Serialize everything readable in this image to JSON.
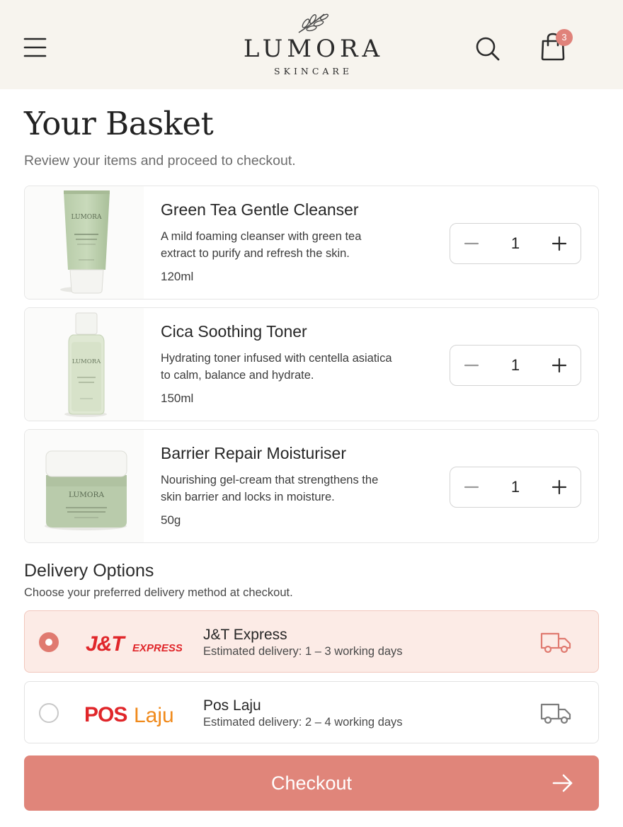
{
  "brand": {
    "name": "LUMORA",
    "tagline": "SKINCARE",
    "accent": "#e0857a"
  },
  "header": {
    "menu_icon": "menu-icon",
    "search_icon": "search-icon",
    "bag_icon": "shopping-bag-icon",
    "cart_count": "3"
  },
  "page": {
    "title": "Your Basket",
    "subtitle": "Review your items and proceed to checkout."
  },
  "items": [
    {
      "name": "Green Tea Gentle Cleanser",
      "description": "A mild foaming cleanser with green tea extract to purify and refresh the skin.",
      "size": "120ml",
      "quantity": "1"
    },
    {
      "name": "Cica Soothing Toner",
      "description": "Hydrating toner infused with centella asiatica to calm, balance and hydrate.",
      "size": "150ml",
      "quantity": "1"
    },
    {
      "name": "Barrier Repair Moisturiser",
      "description": "Nourishing gel-cream that strengthens the skin barrier and locks in moisture.",
      "size": "50g",
      "quantity": "1"
    }
  ],
  "delivery": {
    "title": "Delivery Options",
    "subtitle": "Choose your preferred delivery method at checkout.",
    "options": [
      {
        "name": "J&T Express",
        "eta": "Estimated delivery: 1 – 3 working days",
        "selected": true,
        "logo_text": "J&T EXPRESS"
      },
      {
        "name": "Pos Laju",
        "eta": "Estimated delivery: 2 – 4 working days",
        "selected": false,
        "logo_text": "POS Laju"
      }
    ]
  },
  "checkout": {
    "label": "Checkout",
    "arrow_icon": "arrow-right-icon"
  }
}
